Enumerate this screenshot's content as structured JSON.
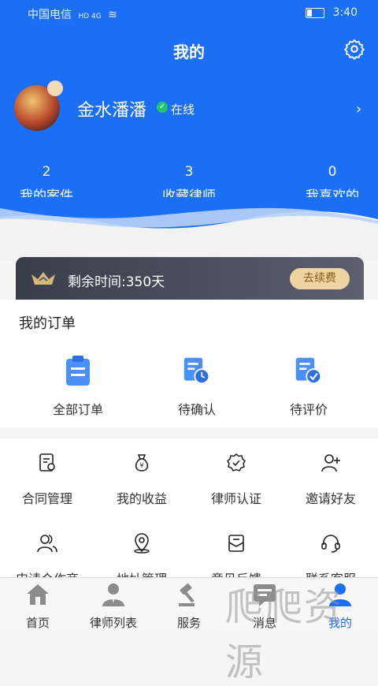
{
  "status_bar": {
    "carrier": "中国电信",
    "network": "HD 4G",
    "time": "3:40"
  },
  "header": {
    "title": "我的"
  },
  "profile": {
    "name": "金水潘潘",
    "status": "在线"
  },
  "stats": [
    {
      "value": "2",
      "label": "我的案件"
    },
    {
      "value": "3",
      "label": "收藏律师"
    },
    {
      "value": "0",
      "label": "我喜欢的"
    }
  ],
  "vip": {
    "remaining": "剩余时间:350天",
    "renew_label": "去续费"
  },
  "orders": {
    "title": "我的订单",
    "items": [
      {
        "label": "全部订单",
        "icon": "clipboard-icon"
      },
      {
        "label": "待确认",
        "icon": "pending-clock-icon"
      },
      {
        "label": "待评价",
        "icon": "review-check-icon"
      }
    ]
  },
  "services": [
    {
      "label": "合同管理",
      "icon": "contract-icon"
    },
    {
      "label": "我的收益",
      "icon": "money-bag-icon"
    },
    {
      "label": "律师认证",
      "icon": "certified-badge-icon"
    },
    {
      "label": "邀请好友",
      "icon": "add-user-icon"
    },
    {
      "label": "申请合作商",
      "icon": "partner-icon"
    },
    {
      "label": "地址管理",
      "icon": "location-pin-icon"
    },
    {
      "label": "意见反馈",
      "icon": "feedback-icon"
    },
    {
      "label": "联系客服",
      "icon": "headset-icon"
    }
  ],
  "bottom_nav": [
    {
      "label": "首页",
      "icon": "home-icon"
    },
    {
      "label": "律师列表",
      "icon": "lawyer-icon"
    },
    {
      "label": "服务",
      "icon": "gavel-icon"
    },
    {
      "label": "消息",
      "icon": "message-icon"
    },
    {
      "label": "我的",
      "icon": "user-icon",
      "active": true
    }
  ],
  "watermark": "爬爬资源",
  "colors": {
    "primary": "#1a6ff5",
    "online": "#24c46b",
    "renew_bg": "#f0d3a2"
  }
}
